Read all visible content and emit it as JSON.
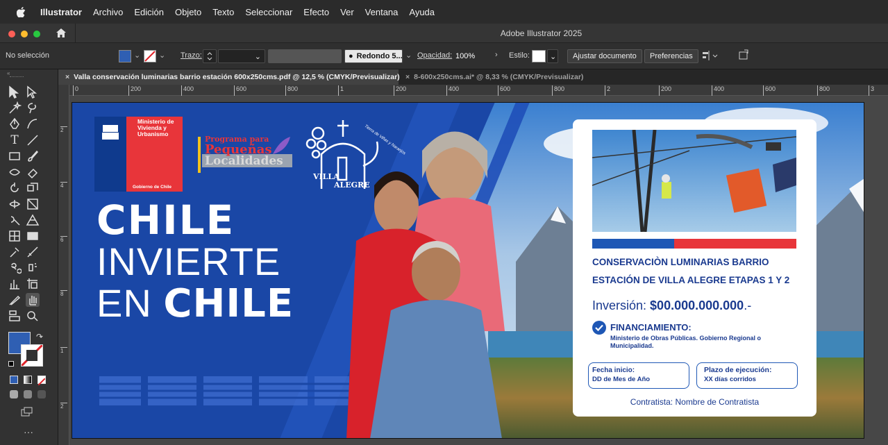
{
  "menubar": {
    "items": [
      "Illustrator",
      "Archivo",
      "Edición",
      "Objeto",
      "Texto",
      "Seleccionar",
      "Efecto",
      "Ver",
      "Ventana",
      "Ayuda"
    ]
  },
  "window": {
    "title": "Adobe Illustrator 2025"
  },
  "controlbar": {
    "selection": "No selección",
    "stroke_label": "Trazo:",
    "brush": "Redondo 5...",
    "opacity_label": "Opacidad:",
    "opacity_value": "100%",
    "style_label": "Estilo:",
    "fit_doc": "Ajustar documento",
    "prefs": "Preferencias",
    "fill_color": "#2f5fb3"
  },
  "tabs": [
    {
      "label": "Valla conservación luminarias barrio estación 600x250cms.pdf @ 12,5 % (CMYK/Previsualizar)"
    },
    {
      "label": "8-600x250cms.ai* @ 8,33 % (CMYK/Previsualizar)"
    }
  ],
  "ruler": {
    "marks": [
      "0",
      "200",
      "400",
      "600",
      "800",
      "1",
      "200",
      "400",
      "600",
      "800",
      "2",
      "200",
      "400",
      "600",
      "800",
      "3"
    ],
    "vmarks": [
      "2",
      "4",
      "6",
      "8",
      "1",
      "2"
    ]
  },
  "artwork": {
    "ministerio": {
      "line1": "Ministerio de",
      "line2": "Vivienda y",
      "line3": "Urbanismo",
      "footer": "Gobierno de Chile"
    },
    "programa": {
      "line1": "Programa para",
      "line2": "Pequeñas",
      "line3": "Localidades"
    },
    "villa": {
      "line1": "VILLA",
      "line2": "ALEGRE",
      "arc": "Tierra de Viñas y Naranjos"
    },
    "headline": {
      "l1": "CHILE",
      "l2": "INVIERTE",
      "l3a": "EN ",
      "l3b": "CHILE"
    },
    "card": {
      "title1": "CONSERVACIÒN LUMINARIAS BARRIO",
      "title2": "ESTACIÓN DE VILLA ALEGRE ETAPAS 1 Y 2",
      "inv_label": "Inversión: ",
      "inv_value": "$00.000.000.000",
      "inv_suffix": ".-",
      "fin_title": "FINANCIAMIENTO:",
      "fin_text1": "Ministerio de Obras Públicas. Gobierno Regional o",
      "fin_text2": "Municipalidad.",
      "start_label": "Fecha inicio:",
      "start_value": "DD de Mes de Año",
      "term_label": "Plazo de ejecución:",
      "term_value": "XX días corridos",
      "contractor": "Contratista: Nombre de Contratista"
    }
  }
}
